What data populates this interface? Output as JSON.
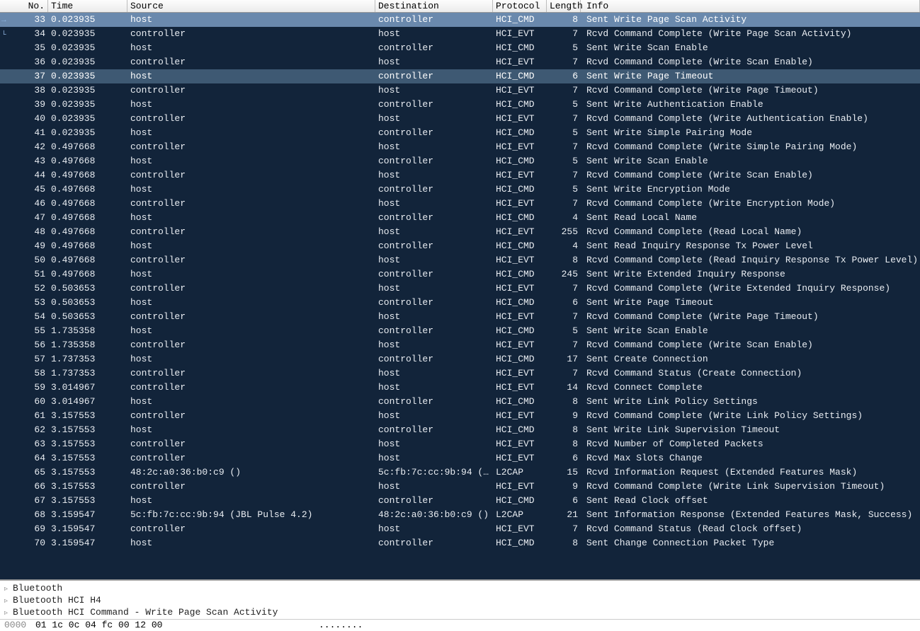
{
  "columns": {
    "no": "No.",
    "time": "Time",
    "source": "Source",
    "destination": "Destination",
    "protocol": "Protocol",
    "length": "Length",
    "info": "Info"
  },
  "selected_primary": 33,
  "selected_secondary": 37,
  "packets": [
    {
      "no": 33,
      "time": "0.023935",
      "src": "host",
      "dst": "controller",
      "proto": "HCI_CMD",
      "len": 8,
      "info": "Sent Write Page Scan Activity"
    },
    {
      "no": 34,
      "time": "0.023935",
      "src": "controller",
      "dst": "host",
      "proto": "HCI_EVT",
      "len": 7,
      "info": "Rcvd Command Complete (Write Page Scan Activity)"
    },
    {
      "no": 35,
      "time": "0.023935",
      "src": "host",
      "dst": "controller",
      "proto": "HCI_CMD",
      "len": 5,
      "info": "Sent Write Scan Enable"
    },
    {
      "no": 36,
      "time": "0.023935",
      "src": "controller",
      "dst": "host",
      "proto": "HCI_EVT",
      "len": 7,
      "info": "Rcvd Command Complete (Write Scan Enable)"
    },
    {
      "no": 37,
      "time": "0.023935",
      "src": "host",
      "dst": "controller",
      "proto": "HCI_CMD",
      "len": 6,
      "info": "Sent Write Page Timeout"
    },
    {
      "no": 38,
      "time": "0.023935",
      "src": "controller",
      "dst": "host",
      "proto": "HCI_EVT",
      "len": 7,
      "info": "Rcvd Command Complete (Write Page Timeout)"
    },
    {
      "no": 39,
      "time": "0.023935",
      "src": "host",
      "dst": "controller",
      "proto": "HCI_CMD",
      "len": 5,
      "info": "Sent Write Authentication Enable"
    },
    {
      "no": 40,
      "time": "0.023935",
      "src": "controller",
      "dst": "host",
      "proto": "HCI_EVT",
      "len": 7,
      "info": "Rcvd Command Complete (Write Authentication Enable)"
    },
    {
      "no": 41,
      "time": "0.023935",
      "src": "host",
      "dst": "controller",
      "proto": "HCI_CMD",
      "len": 5,
      "info": "Sent Write Simple Pairing Mode"
    },
    {
      "no": 42,
      "time": "0.497668",
      "src": "controller",
      "dst": "host",
      "proto": "HCI_EVT",
      "len": 7,
      "info": "Rcvd Command Complete (Write Simple Pairing Mode)"
    },
    {
      "no": 43,
      "time": "0.497668",
      "src": "host",
      "dst": "controller",
      "proto": "HCI_CMD",
      "len": 5,
      "info": "Sent Write Scan Enable"
    },
    {
      "no": 44,
      "time": "0.497668",
      "src": "controller",
      "dst": "host",
      "proto": "HCI_EVT",
      "len": 7,
      "info": "Rcvd Command Complete (Write Scan Enable)"
    },
    {
      "no": 45,
      "time": "0.497668",
      "src": "host",
      "dst": "controller",
      "proto": "HCI_CMD",
      "len": 5,
      "info": "Sent Write Encryption Mode"
    },
    {
      "no": 46,
      "time": "0.497668",
      "src": "controller",
      "dst": "host",
      "proto": "HCI_EVT",
      "len": 7,
      "info": "Rcvd Command Complete (Write Encryption Mode)"
    },
    {
      "no": 47,
      "time": "0.497668",
      "src": "host",
      "dst": "controller",
      "proto": "HCI_CMD",
      "len": 4,
      "info": "Sent Read Local Name"
    },
    {
      "no": 48,
      "time": "0.497668",
      "src": "controller",
      "dst": "host",
      "proto": "HCI_EVT",
      "len": 255,
      "info": "Rcvd Command Complete (Read Local Name)"
    },
    {
      "no": 49,
      "time": "0.497668",
      "src": "host",
      "dst": "controller",
      "proto": "HCI_CMD",
      "len": 4,
      "info": "Sent Read Inquiry Response Tx Power Level"
    },
    {
      "no": 50,
      "time": "0.497668",
      "src": "controller",
      "dst": "host",
      "proto": "HCI_EVT",
      "len": 8,
      "info": "Rcvd Command Complete (Read Inquiry Response Tx Power Level)"
    },
    {
      "no": 51,
      "time": "0.497668",
      "src": "host",
      "dst": "controller",
      "proto": "HCI_CMD",
      "len": 245,
      "info": "Sent Write Extended Inquiry Response"
    },
    {
      "no": 52,
      "time": "0.503653",
      "src": "controller",
      "dst": "host",
      "proto": "HCI_EVT",
      "len": 7,
      "info": "Rcvd Command Complete (Write Extended Inquiry Response)"
    },
    {
      "no": 53,
      "time": "0.503653",
      "src": "host",
      "dst": "controller",
      "proto": "HCI_CMD",
      "len": 6,
      "info": "Sent Write Page Timeout"
    },
    {
      "no": 54,
      "time": "0.503653",
      "src": "controller",
      "dst": "host",
      "proto": "HCI_EVT",
      "len": 7,
      "info": "Rcvd Command Complete (Write Page Timeout)"
    },
    {
      "no": 55,
      "time": "1.735358",
      "src": "host",
      "dst": "controller",
      "proto": "HCI_CMD",
      "len": 5,
      "info": "Sent Write Scan Enable"
    },
    {
      "no": 56,
      "time": "1.735358",
      "src": "controller",
      "dst": "host",
      "proto": "HCI_EVT",
      "len": 7,
      "info": "Rcvd Command Complete (Write Scan Enable)"
    },
    {
      "no": 57,
      "time": "1.737353",
      "src": "host",
      "dst": "controller",
      "proto": "HCI_CMD",
      "len": 17,
      "info": "Sent Create Connection"
    },
    {
      "no": 58,
      "time": "1.737353",
      "src": "controller",
      "dst": "host",
      "proto": "HCI_EVT",
      "len": 7,
      "info": "Rcvd Command Status (Create Connection)"
    },
    {
      "no": 59,
      "time": "3.014967",
      "src": "controller",
      "dst": "host",
      "proto": "HCI_EVT",
      "len": 14,
      "info": "Rcvd Connect Complete"
    },
    {
      "no": 60,
      "time": "3.014967",
      "src": "host",
      "dst": "controller",
      "proto": "HCI_CMD",
      "len": 8,
      "info": "Sent Write Link Policy Settings"
    },
    {
      "no": 61,
      "time": "3.157553",
      "src": "controller",
      "dst": "host",
      "proto": "HCI_EVT",
      "len": 9,
      "info": "Rcvd Command Complete (Write Link Policy Settings)"
    },
    {
      "no": 62,
      "time": "3.157553",
      "src": "host",
      "dst": "controller",
      "proto": "HCI_CMD",
      "len": 8,
      "info": "Sent Write Link Supervision Timeout"
    },
    {
      "no": 63,
      "time": "3.157553",
      "src": "controller",
      "dst": "host",
      "proto": "HCI_EVT",
      "len": 8,
      "info": "Rcvd Number of Completed Packets"
    },
    {
      "no": 64,
      "time": "3.157553",
      "src": "controller",
      "dst": "host",
      "proto": "HCI_EVT",
      "len": 6,
      "info": "Rcvd Max Slots Change"
    },
    {
      "no": 65,
      "time": "3.157553",
      "src": "48:2c:a0:36:b0:c9 ()",
      "dst": "5c:fb:7c:cc:9b:94 (…",
      "proto": "L2CAP",
      "len": 15,
      "info": "Rcvd Information Request (Extended Features Mask)"
    },
    {
      "no": 66,
      "time": "3.157553",
      "src": "controller",
      "dst": "host",
      "proto": "HCI_EVT",
      "len": 9,
      "info": "Rcvd Command Complete (Write Link Supervision Timeout)"
    },
    {
      "no": 67,
      "time": "3.157553",
      "src": "host",
      "dst": "controller",
      "proto": "HCI_CMD",
      "len": 6,
      "info": "Sent Read Clock offset"
    },
    {
      "no": 68,
      "time": "3.159547",
      "src": "5c:fb:7c:cc:9b:94 (JBL Pulse 4.2)",
      "dst": "48:2c:a0:36:b0:c9 ()",
      "proto": "L2CAP",
      "len": 21,
      "info": "Sent Information Response (Extended Features Mask, Success)"
    },
    {
      "no": 69,
      "time": "3.159547",
      "src": "controller",
      "dst": "host",
      "proto": "HCI_EVT",
      "len": 7,
      "info": "Rcvd Command Status (Read Clock offset)"
    },
    {
      "no": 70,
      "time": "3.159547",
      "src": "host",
      "dst": "controller",
      "proto": "HCI_CMD",
      "len": 8,
      "info": "Sent Change Connection Packet Type"
    }
  ],
  "tree": [
    "Bluetooth",
    "Bluetooth HCI H4",
    "Bluetooth HCI Command - Write Page Scan Activity"
  ],
  "hex": {
    "offset": "0000",
    "bytes": "01 1c 0c 04 fc 00 12 00",
    "ascii": "........"
  }
}
